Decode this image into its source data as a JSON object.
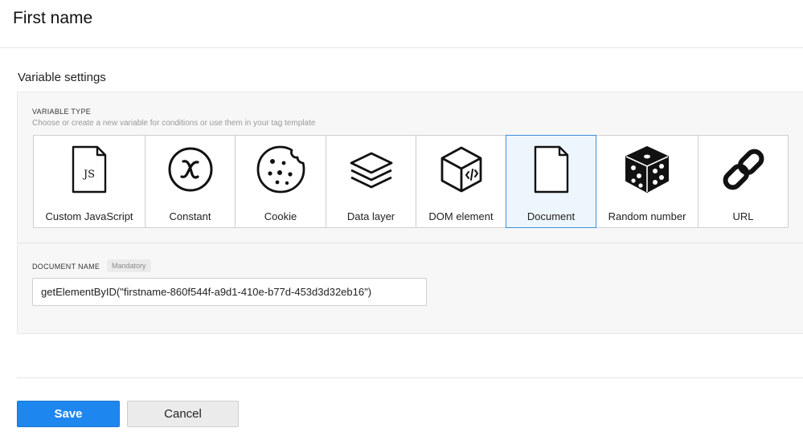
{
  "page": {
    "title": "First name"
  },
  "variable_settings": {
    "title": "Variable settings",
    "variable_type_label": "VARIABLE TYPE",
    "variable_type_hint": "Choose or create a new variable for conditions or use them in your tag template",
    "types": [
      {
        "label": "Custom JavaScript",
        "icon": "js-file-icon",
        "selected": false
      },
      {
        "label": "Constant",
        "icon": "constant-x-icon",
        "selected": false
      },
      {
        "label": "Cookie",
        "icon": "cookie-icon",
        "selected": false
      },
      {
        "label": "Data layer",
        "icon": "layers-icon",
        "selected": false
      },
      {
        "label": "DOM element",
        "icon": "dom-cube-icon",
        "selected": false
      },
      {
        "label": "Document",
        "icon": "document-icon",
        "selected": true
      },
      {
        "label": "Random number",
        "icon": "dice-icon",
        "selected": false
      },
      {
        "label": "URL",
        "icon": "link-icon",
        "selected": false
      }
    ],
    "document_name_label": "DOCUMENT NAME",
    "mandatory_badge": "Mandatory",
    "document_name_value": "getElementByID(\"firstname-860f544f-a9d1-410e-b77d-453d3d32eb16\")",
    "js_icon_text": "JS"
  },
  "actions": {
    "save_label": "Save",
    "cancel_label": "Cancel"
  },
  "colors": {
    "accent": "#1e87ef",
    "selected_border": "#3b8fd8",
    "selected_bg": "#eef6fd"
  }
}
